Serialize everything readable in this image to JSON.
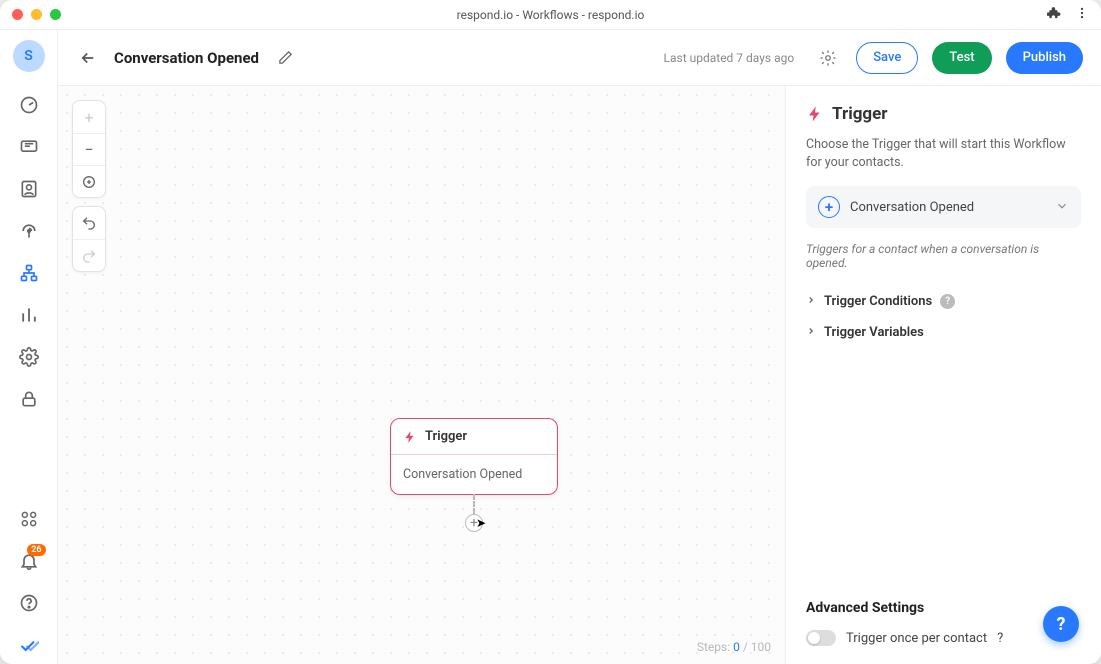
{
  "window": {
    "title": "respond.io - Workflows - respond.io"
  },
  "avatar": {
    "initial": "S"
  },
  "notifications": {
    "count": "26"
  },
  "header": {
    "workflow_title": "Conversation Opened",
    "last_updated": "Last updated 7 days ago",
    "save_label": "Save",
    "test_label": "Test",
    "publish_label": "Publish"
  },
  "canvas": {
    "node_title": "Trigger",
    "node_subtitle": "Conversation Opened",
    "steps_label": "Steps:",
    "steps_current": "0",
    "steps_max": "100"
  },
  "panel": {
    "title": "Trigger",
    "description": "Choose the Trigger that will start this Workflow for your contacts.",
    "selected_trigger": "Conversation Opened",
    "hint": "Triggers for a contact when a conversation is opened.",
    "conditions_label": "Trigger Conditions",
    "variables_label": "Trigger Variables",
    "advanced_title": "Advanced Settings",
    "toggle_label": "Trigger once per contact"
  }
}
